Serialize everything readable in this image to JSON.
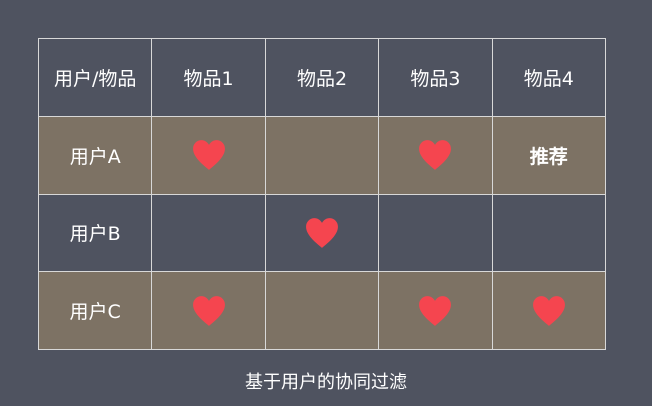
{
  "table": {
    "header": [
      "用户/物品",
      "物品1",
      "物品2",
      "物品3",
      "物品4"
    ],
    "rows": [
      {
        "user": "用户A",
        "cells": [
          "heart",
          "",
          "heart",
          "推荐"
        ]
      },
      {
        "user": "用户B",
        "cells": [
          "",
          "heart",
          "",
          ""
        ]
      },
      {
        "user": "用户C",
        "cells": [
          "heart",
          "",
          "heart",
          "heart"
        ]
      }
    ]
  },
  "caption": "基于用户的协同过滤",
  "colors": {
    "background": "#4f5360",
    "tan_row": "#7d7264",
    "heart": "#f5454f",
    "grid_line": "#d8d8d8"
  },
  "icons": {
    "heart": "heart-icon"
  }
}
